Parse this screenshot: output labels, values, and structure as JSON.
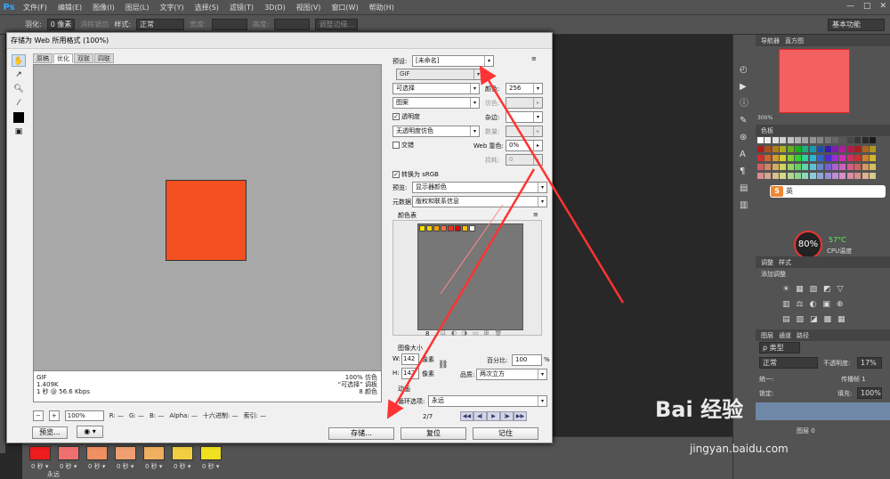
{
  "app": {
    "logo": "Ps",
    "menus": [
      "文件(F)",
      "编辑(E)",
      "图像(I)",
      "图层(L)",
      "文字(Y)",
      "选择(S)",
      "滤镜(T)",
      "3D(D)",
      "视图(V)",
      "窗口(W)",
      "帮助(H)"
    ],
    "options": {
      "feather_label": "羽化:",
      "feather_value": "0 像素",
      "antialias": "消除锯齿",
      "style_label": "样式:",
      "style_value": "正常",
      "width_label": "宽度:",
      "height_label": "高度:",
      "refine": "调整边缘...",
      "workspace": "基本功能"
    }
  },
  "right_panel": {
    "nav_tabs": [
      "导航器",
      "直方图"
    ],
    "nav_zoom": "300%",
    "swatches_tab": "色板",
    "ime_label": "英",
    "cpu_percent": "80%",
    "cpu_temp": "57°C",
    "cpu_label": "CPU温度",
    "adjust_tabs": [
      "调整",
      "样式"
    ],
    "adjust_title": "添加调整",
    "layers_tabs": [
      "图层",
      "通道",
      "路径"
    ],
    "layer_kind": "ρ 类型",
    "blend_mode": "正常",
    "opacity_label": "不透明度:",
    "opacity_value": "17%",
    "propagate": "传播帧 1",
    "unify": "统一:",
    "lock": "锁定:",
    "fill_label": "填充:",
    "fill_value": "100%",
    "layer_name": "图层 0"
  },
  "timeline": {
    "frames": [
      {
        "time": "0 秒",
        "color": "#ee1c1c"
      },
      {
        "time": "0 秒",
        "color": "#f07070"
      },
      {
        "time": "0 秒",
        "color": "#f09060"
      },
      {
        "time": "0 秒",
        "color": "#f0a070"
      },
      {
        "time": "0 秒",
        "color": "#f0b060"
      },
      {
        "time": "0 秒",
        "color": "#f0d040"
      },
      {
        "time": "0 秒",
        "color": "#f0e020"
      }
    ],
    "loop": "永远"
  },
  "dialog": {
    "title": "存储为 Web 所用格式 (100%)",
    "view_tabs": [
      "原稿",
      "优化",
      "双联",
      "四联"
    ],
    "info_left": [
      "GIF",
      "1.409K",
      "1 秒 @ 56.6 Kbps"
    ],
    "info_right": [
      "100% 仿色",
      "“可选择” 调板",
      "8 颜色"
    ],
    "zoom": "100%",
    "readout": {
      "r": "R: —",
      "g": "G: —",
      "b": "B: —",
      "alpha": "Alpha: —",
      "hex": "十六进制: —",
      "index": "索引: —"
    },
    "preview_btn": "预览...",
    "save_btn": "存储...",
    "reset_btn": "复位",
    "remember_btn": "记住",
    "settings": {
      "preset_label": "预设:",
      "preset_value": "[未命名]",
      "format": "GIF",
      "reduction": "可选择",
      "colors_label": "颜色:",
      "colors_value": "256",
      "dither_algo": "图案",
      "dither_label": "仿色:",
      "transparency": "透明度",
      "matte_label": "杂边:",
      "trans_dither": "无透明度仿色",
      "amount_label": "数量:",
      "interlaced": "交错",
      "websnap_label": "Web 靠色:",
      "websnap_value": "0%",
      "lossy_label": "损耗:",
      "lossy_value": "0",
      "convert_srgb": "转换为 sRGB",
      "preview_label": "预览:",
      "preview_value": "显示器颜色",
      "metadata_label": "元数据:",
      "metadata_value": "版权和联系信息",
      "color_table_label": "颜色表",
      "color_count": "8",
      "image_size_label": "图像大小",
      "w_label": "W:",
      "w_value": "142",
      "h_label": "H:",
      "h_value": "142",
      "px": "像素",
      "percent_label": "百分比:",
      "percent_value": "100",
      "pct": "%",
      "quality_label": "品质:",
      "quality_value": "两次立方",
      "anim_label": "动画",
      "loop_label": "循环选项:",
      "loop_value": "永远",
      "frame_counter": "2/7"
    }
  },
  "watermark": {
    "brand": "Bai  经验",
    "url": "jingyan.baidu.com"
  }
}
